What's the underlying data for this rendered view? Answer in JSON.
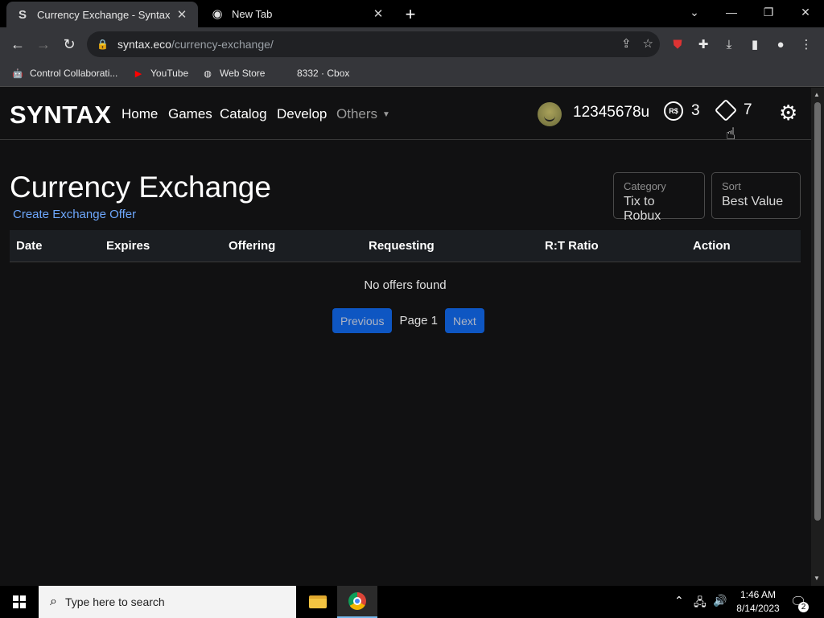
{
  "browser": {
    "tabs": [
      {
        "title": "Currency Exchange - Syntax",
        "favicon": "S"
      },
      {
        "title": "New Tab"
      }
    ],
    "url_host": "syntax.eco",
    "url_path": "/currency-exchange/",
    "bookmarks": [
      {
        "label": "Control Collaborati...",
        "icon": "robot-icon"
      },
      {
        "label": "YouTube",
        "icon": "youtube-icon"
      },
      {
        "label": "Web Store",
        "icon": "web-store-icon"
      },
      {
        "label": "8332 · Cbox",
        "icon": "cbox-icon"
      }
    ]
  },
  "site": {
    "logo": "SYNTAX",
    "nav": [
      "Home",
      "Games",
      "Catalog",
      "Develop",
      "Others"
    ],
    "username": "12345678u",
    "robux": "3",
    "robux_icon_text": "R$",
    "tix": "7"
  },
  "main": {
    "title": "Currency Exchange",
    "create_link": "Create Exchange Offer",
    "filters": [
      {
        "label": "Category",
        "value": "Tix to Robux"
      },
      {
        "label": "Sort",
        "value": "Best Value"
      }
    ],
    "columns": [
      "Date",
      "Expires",
      "Offering",
      "Requesting",
      "R:T Ratio",
      "Action"
    ],
    "empty_message": "No offers found",
    "pager": {
      "prev": "Previous",
      "page": "Page 1",
      "next": "Next"
    }
  },
  "taskbar": {
    "search_placeholder": "Type here to search",
    "time": "1:46 AM",
    "date": "8/14/2023",
    "notifications": "2"
  },
  "colors": {
    "accent": "#0d6efd",
    "link": "#6ea8fe",
    "background": "#111112"
  }
}
